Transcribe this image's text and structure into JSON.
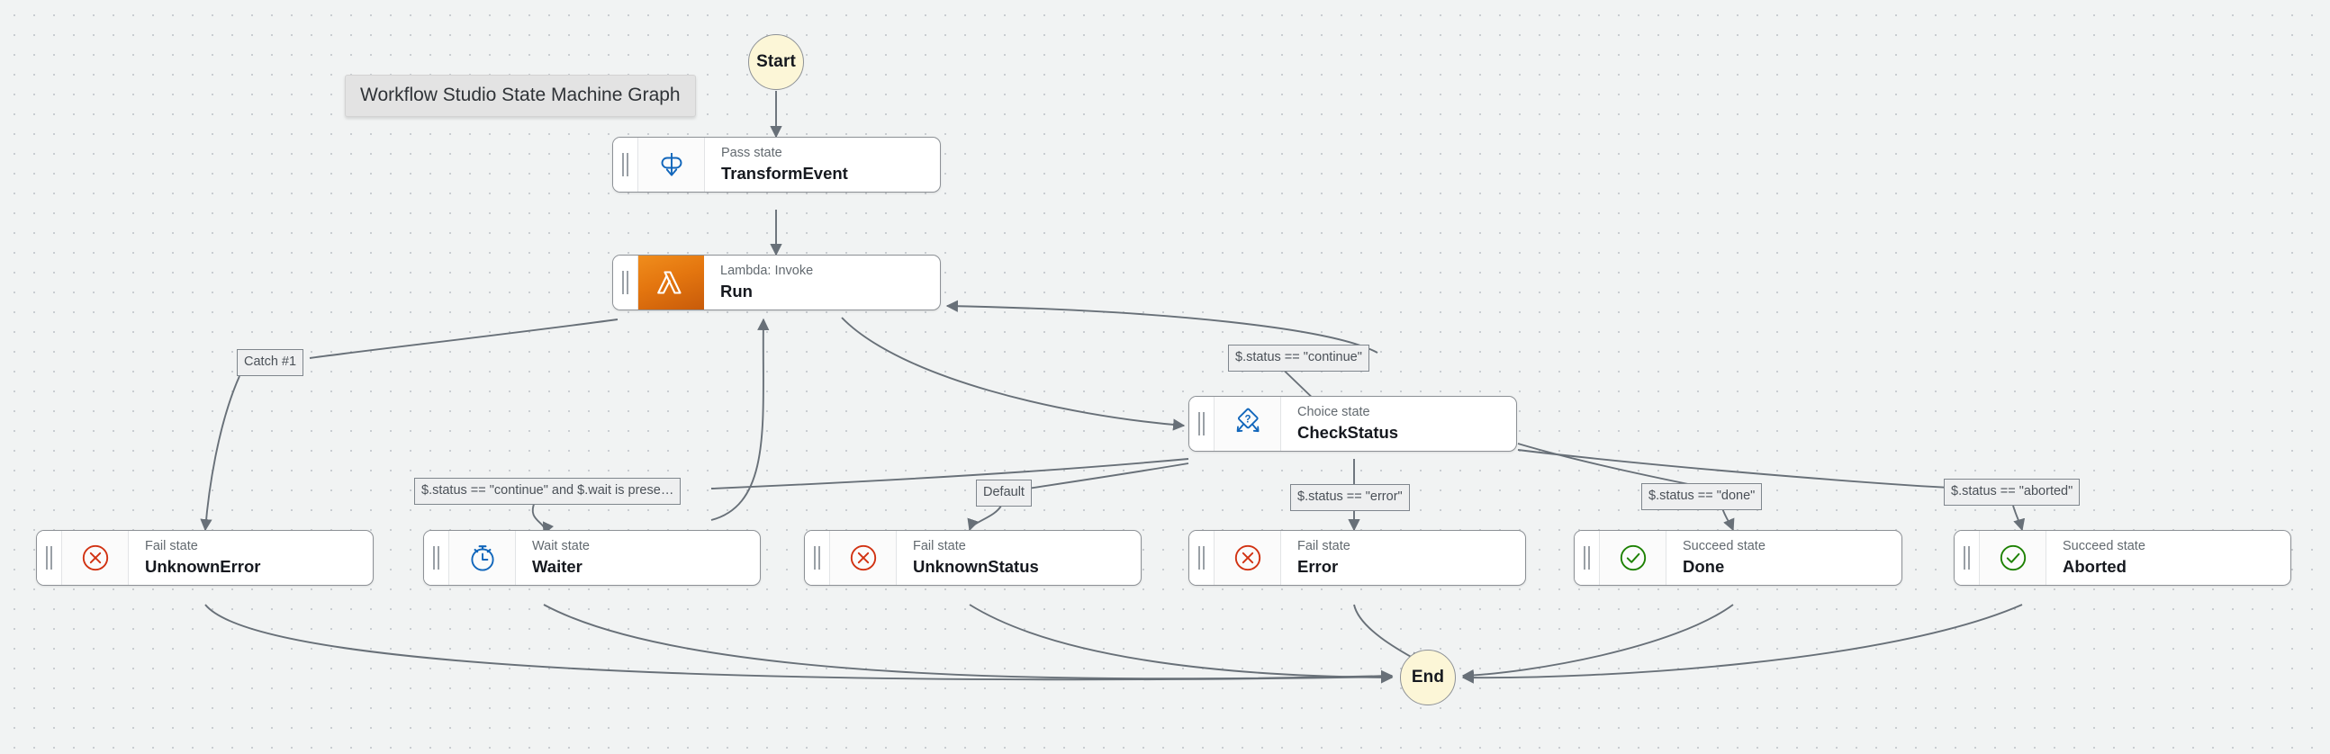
{
  "graph": {
    "title": "Workflow Studio State Machine Graph",
    "terminals": [
      {
        "id": "start",
        "label": "Start"
      },
      {
        "id": "end",
        "label": "End"
      }
    ],
    "nodes": [
      {
        "id": "TransformEvent",
        "kind": "Pass state",
        "name": "TransformEvent",
        "icon": "pass-state-icon"
      },
      {
        "id": "Run",
        "kind": "Lambda: Invoke",
        "name": "Run",
        "icon": "lambda-icon"
      },
      {
        "id": "CheckStatus",
        "kind": "Choice state",
        "name": "CheckStatus",
        "icon": "choice-state-icon"
      },
      {
        "id": "UnknownError",
        "kind": "Fail state",
        "name": "UnknownError",
        "icon": "fail-state-icon"
      },
      {
        "id": "Waiter",
        "kind": "Wait state",
        "name": "Waiter",
        "icon": "wait-state-icon"
      },
      {
        "id": "UnknownStatus",
        "kind": "Fail state",
        "name": "UnknownStatus",
        "icon": "fail-state-icon"
      },
      {
        "id": "Error",
        "kind": "Fail state",
        "name": "Error",
        "icon": "fail-state-icon"
      },
      {
        "id": "Done",
        "kind": "Succeed state",
        "name": "Done",
        "icon": "succeed-state-icon"
      },
      {
        "id": "Aborted",
        "kind": "Succeed state",
        "name": "Aborted",
        "icon": "succeed-state-icon"
      }
    ],
    "edge_labels": [
      {
        "id": "catch-1",
        "text": "Catch #1"
      },
      {
        "id": "continue",
        "text": "$.status == \"continue\""
      },
      {
        "id": "continue-wait",
        "text": "$.status == \"continue\" and $.wait is prese…"
      },
      {
        "id": "default",
        "text": "Default"
      },
      {
        "id": "error",
        "text": "$.status == \"error\""
      },
      {
        "id": "done",
        "text": "$.status == \"done\""
      },
      {
        "id": "aborted",
        "text": "$.status == \"aborted\""
      }
    ],
    "colors": {
      "canvas": "#f1f3f3",
      "terminal_fill": "#fcf6d7",
      "node_border": "#8d9196",
      "edge_stroke": "#687078",
      "lambda_orange": "#e4760f",
      "fail_red": "#d13212",
      "succeed_green": "#1d8102",
      "state_blue": "#1166bb"
    }
  }
}
